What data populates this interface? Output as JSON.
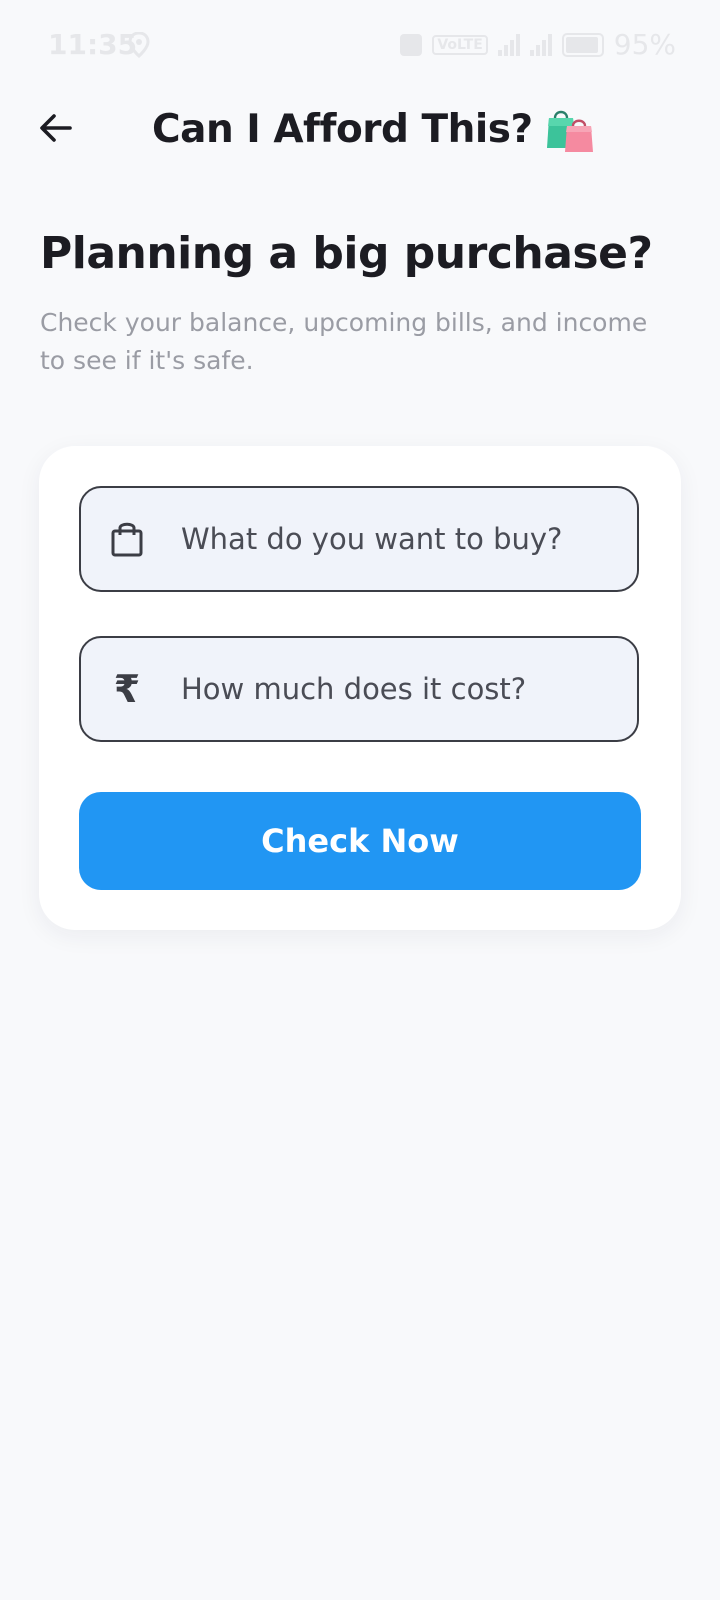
{
  "status_bar": {
    "time": "11:35",
    "volte_tag": "VoLTE",
    "battery": "95%"
  },
  "app_bar": {
    "title": "Can I Afford This?",
    "title_emoji_icon": "shopping-bags-icon",
    "back_icon": "arrow-left-icon"
  },
  "main": {
    "heading": "Planning a big purchase?",
    "subtext": "Check your balance, upcoming bills, and income to see if it's safe."
  },
  "form": {
    "item_field": {
      "icon": "shopping-bag-icon",
      "placeholder": "What do you want to buy?",
      "value": ""
    },
    "cost_field": {
      "icon": "rupee-icon",
      "icon_glyph": "₹",
      "placeholder": "How much does it cost?",
      "value": ""
    },
    "submit_label": "Check Now"
  },
  "colors": {
    "accent": "#2196f3",
    "background": "#f8f9fb",
    "card": "#ffffff",
    "field_fill": "#f0f3fa",
    "field_border": "#3b3d45",
    "subtext": "#9a9ca4"
  }
}
